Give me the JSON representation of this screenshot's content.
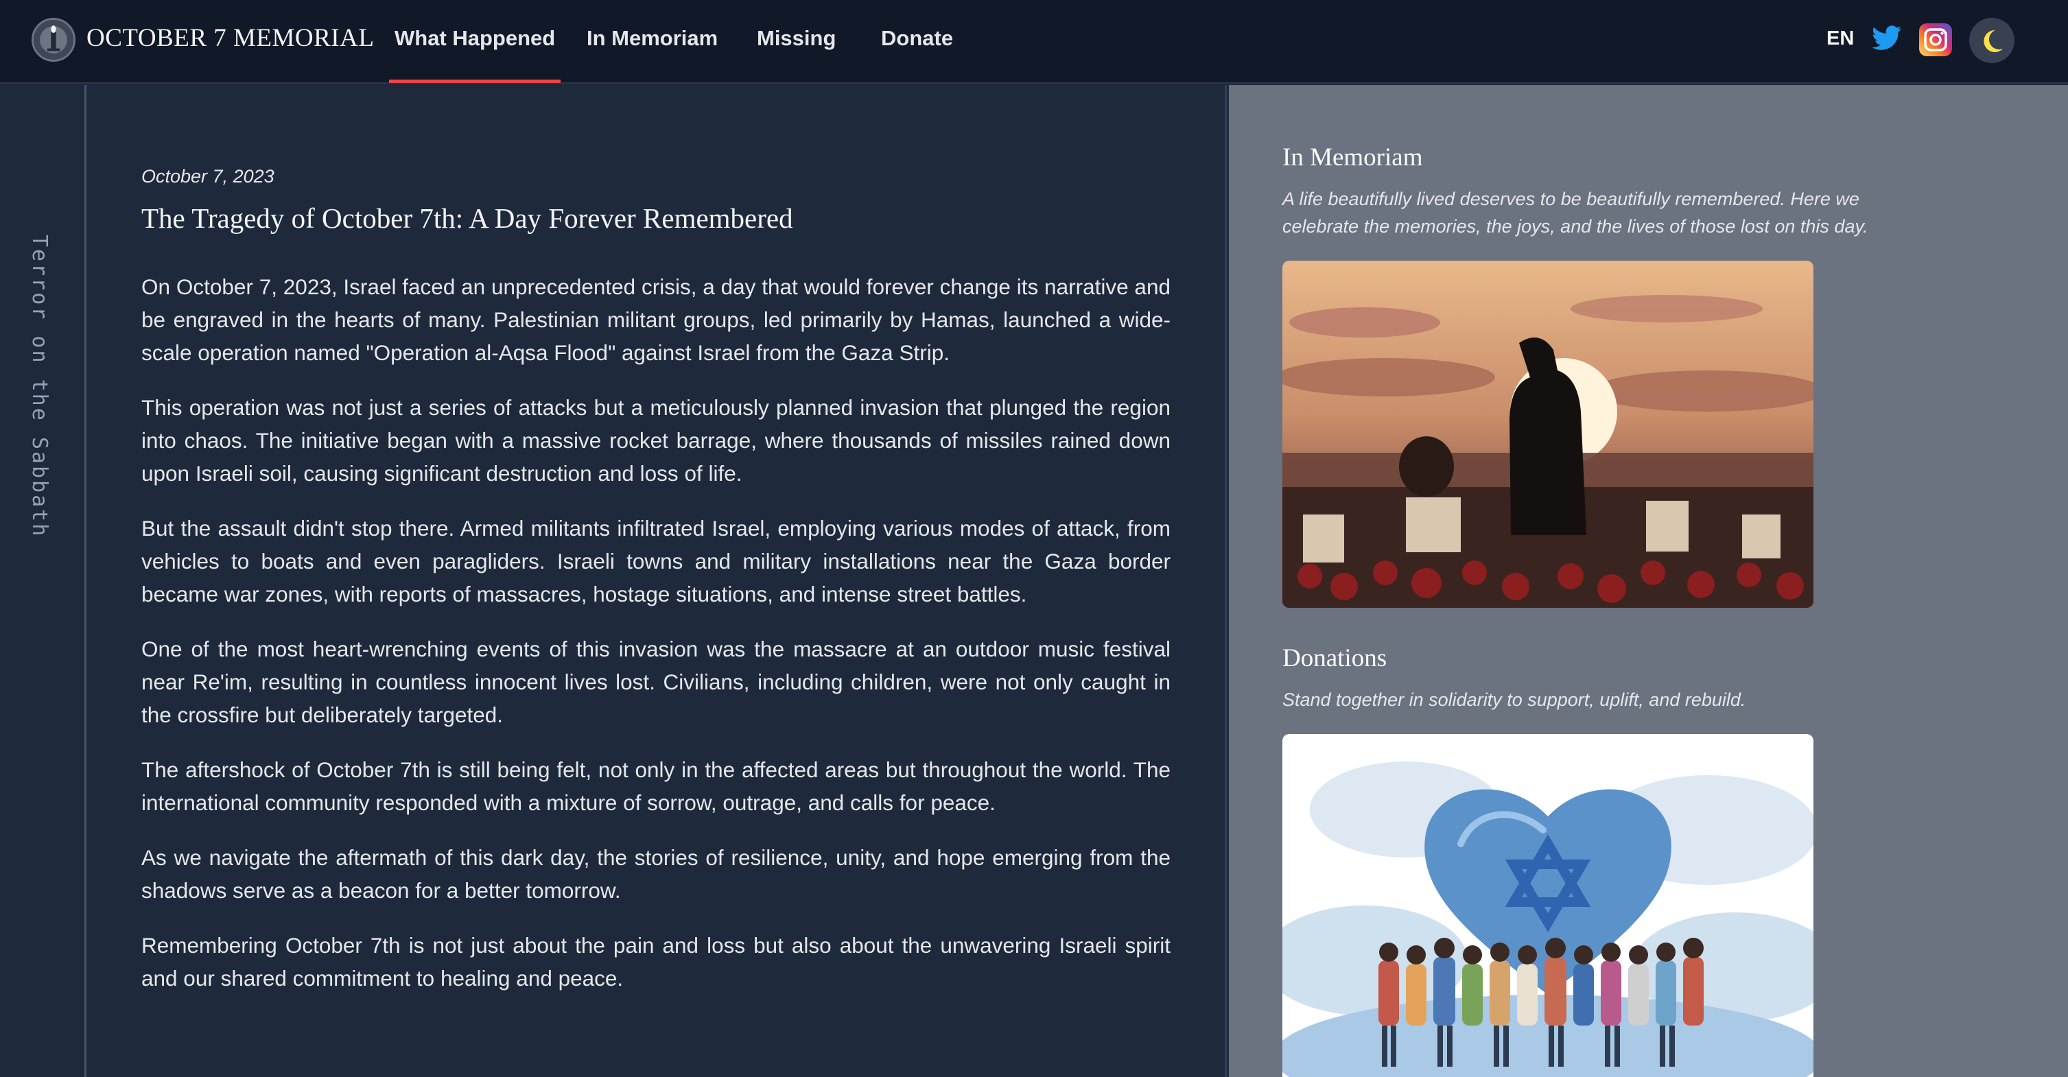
{
  "header": {
    "brand": "OCTOBER 7 MEMORIAL",
    "logo_icon": "memorial-candle-logo",
    "nav": [
      {
        "label": "What Happened",
        "active": true
      },
      {
        "label": "In Memoriam",
        "active": false
      },
      {
        "label": "Missing",
        "active": false
      },
      {
        "label": "Donate",
        "active": false
      }
    ],
    "language": "EN",
    "icons": [
      "twitter-icon",
      "instagram-icon",
      "moon-icon"
    ]
  },
  "rail": {
    "label": "Terror on the Sabbath"
  },
  "article": {
    "date": "October 7, 2023",
    "title": "The Tragedy of October 7th: A Day Forever Remembered",
    "paragraphs": [
      "On October 7, 2023, Israel faced an unprecedented crisis, a day that would forever change its narrative and be engraved in the hearts of many. Palestinian militant groups, led primarily by Hamas, launched a wide-scale operation named \"Operation al-Aqsa Flood\" against Israel from the Gaza Strip.",
      "This operation was not just a series of attacks but a meticulously planned invasion that plunged the region into chaos. The initiative began with a massive rocket barrage, where thousands of missiles rained down upon Israeli soil, causing significant destruction and loss of life.",
      "But the assault didn't stop there. Armed militants infiltrated Israel, employing various modes of attack, from vehicles to boats and even paragliders. Israeli towns and military installations near the Gaza border became war zones, with reports of massacres, hostage situations, and intense street battles.",
      "One of the most heart-wrenching events of this invasion was the massacre at an outdoor music festival near Re'im, resulting in countless innocent lives lost. Civilians, including children, were not only caught in the crossfire but deliberately targeted.",
      "The aftershock of October 7th is still being felt, not only in the affected areas but throughout the world. The international community responded with a mixture of sorrow, outrage, and calls for peace.",
      "As we navigate the aftermath of this dark day, the stories of resilience, unity, and hope emerging from the shadows serve as a beacon for a better tomorrow.",
      "Remembering October 7th is not just about the pain and loss but also about the unwavering Israeli spirit and our shared commitment to healing and peace."
    ]
  },
  "sidebar": {
    "memoriam": {
      "heading": "In Memoriam",
      "subtitle": "A life beautifully lived deserves to be beautifully remembered. Here we celebrate the memories, the joys, and the lives of those lost on this day.",
      "image_icon": "mourning-illustration"
    },
    "donations": {
      "heading": "Donations",
      "subtitle": "Stand together in solidarity to support, uplift, and rebuild.",
      "image_icon": "solidarity-heart-illustration"
    }
  },
  "colors": {
    "header_bg": "#111827",
    "page_bg": "#1e293b",
    "sidebar_bg": "#6b7280",
    "active_underline": "#ef4444"
  }
}
